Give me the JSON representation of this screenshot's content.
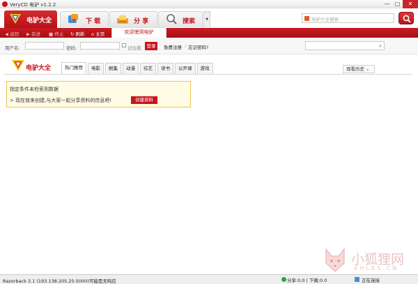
{
  "window": {
    "title": "VeryCD 电驴 v1.2.2",
    "controls": {
      "minimize": "—",
      "maximize": "□",
      "close": "✕"
    }
  },
  "main_tabs": {
    "brand": "电驴大全",
    "download": "下 载",
    "share": "分 享",
    "search": "搜索",
    "dropdown": "▼"
  },
  "top_search": {
    "placeholder": "电驴大全搜索",
    "button_icon": "search-icon"
  },
  "nav": {
    "back": "返回",
    "forward": "前进",
    "stop": "终止",
    "refresh": "刷新",
    "home": "主页",
    "welcome_tab": "欢迎使用电驴"
  },
  "login": {
    "username_label": "用户名:",
    "password_label": "密码:",
    "remember": "记住我",
    "login_button": "登录",
    "register": "免费注册",
    "forgot": "忘记密码?"
  },
  "brand_logo": "电驴大全",
  "categories": [
    "热门推荐",
    "电影",
    "剧集",
    "动漫",
    "综艺",
    "读书",
    "公开课",
    "游戏"
  ],
  "history_button": "观看历史",
  "notice": {
    "title": "指定条件未检索到数据",
    "text": "> 现在就来创建,与大家一起分享资料的信息吧!",
    "create_button": "创建资料"
  },
  "watermark": {
    "cn": "小狐狸网",
    "en": "XHLKS.CN"
  },
  "status": {
    "left": "Razorback 3.1 (193.138.205.25:5000)可能是无响应",
    "share": "分享:0.0 | 下载:0.0",
    "connection": "正在连接"
  },
  "colors": {
    "accent": "#c8141b",
    "notice_bg": "#fffce6",
    "notice_border": "#eec34f"
  }
}
